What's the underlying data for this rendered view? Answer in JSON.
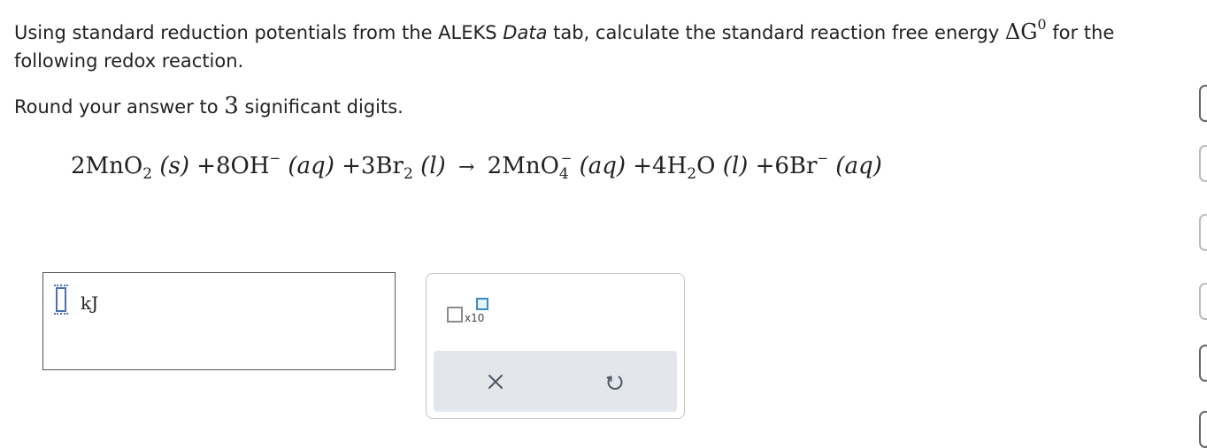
{
  "question": {
    "line1_a": "Using standard reduction potentials from the ALEKS ",
    "line1_data": "Data",
    "line1_b": " tab, calculate the standard reaction free energy ",
    "delta_g": "ΔG",
    "delta_g_sup": "0",
    "line1_c": " for the",
    "line2": "following redox reaction.",
    "round_a": "Round your answer to ",
    "round_num": "3",
    "round_b": " significant digits."
  },
  "equation": {
    "r1_coef": "2MnO",
    "r1_sub": "2",
    "r1_state": "(s)",
    "r2_coef": "+8OH",
    "r2_sup": "−",
    "r2_state": "(aq)",
    "r3_coef": "+3Br",
    "r3_sub": "2",
    "r3_state": "(l)",
    "arrow": "→",
    "p1_coef": "2MnO",
    "p1_sub": "4",
    "p1_sup": "−",
    "p1_state": "(aq)",
    "p2_coef": "+4H",
    "p2_sub": "2",
    "p2_o": "O",
    "p2_state": "(l)",
    "p3_coef": "+6Br",
    "p3_sup": "−",
    "p3_state": "(aq)"
  },
  "answer": {
    "value": "",
    "unit": "kJ"
  },
  "tools": {
    "x10_label": "x10",
    "clear_symbol": "×",
    "undo_symbol": "undo"
  },
  "colors": {
    "accent": "#3d8ac9",
    "cursor": "#4a6fb5",
    "toolbar_bg": "#e3e7ec"
  }
}
